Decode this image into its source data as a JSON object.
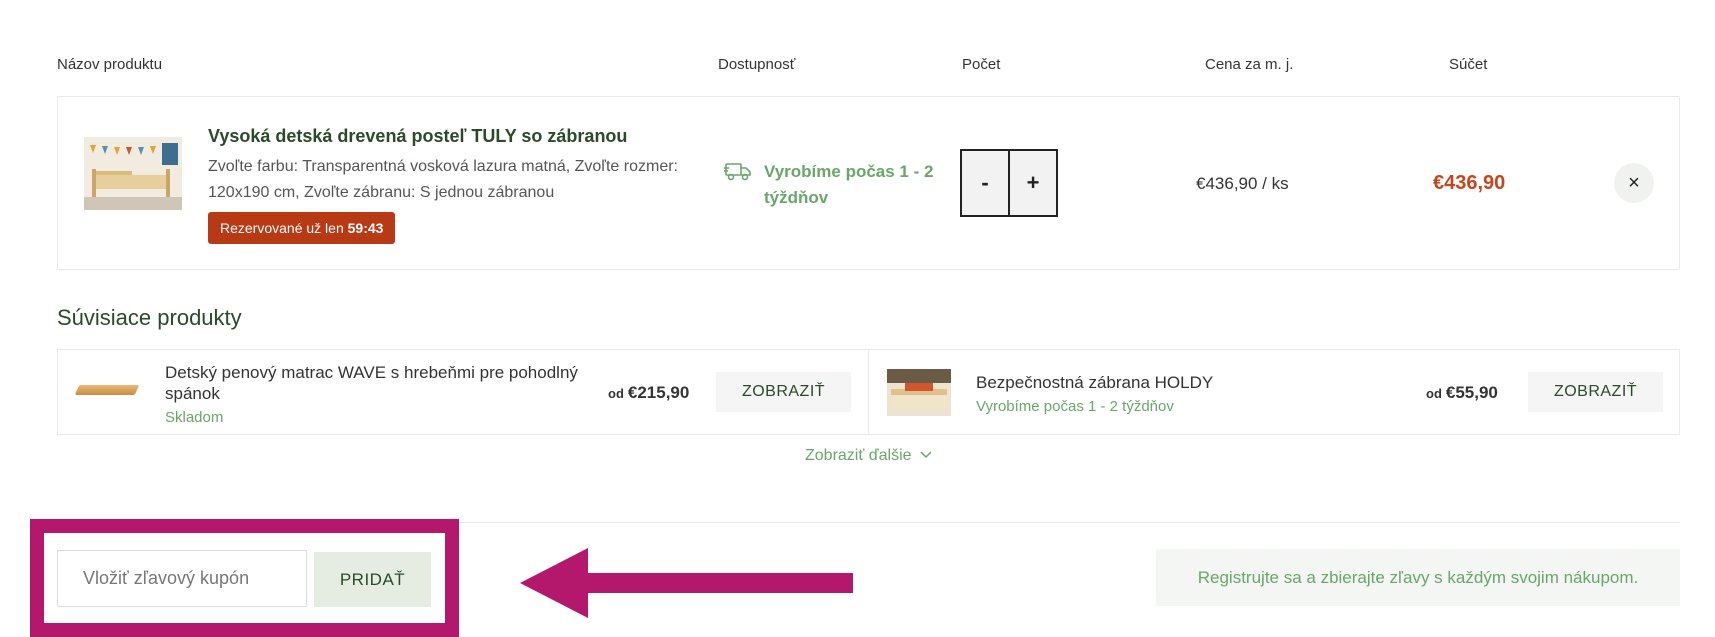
{
  "table_header": {
    "name": "Názov produktu",
    "availability": "Dostupnosť",
    "quantity": "Počet",
    "unit_price": "Cena za m. j.",
    "total": "Súčet"
  },
  "cart_item": {
    "title": "Vysoká detská drevená posteľ TULY so zábranou",
    "description": "Zvoľte farbu: Transparentná vosková lazura matná, Zvoľte rozmer: 120x190 cm, Zvoľte zábranu: S jednou zábranou",
    "reserve_label": "Rezervované už len",
    "reserve_time": "59:43",
    "availability": "Vyrobíme počas 1 - 2 týždňov",
    "minus": "-",
    "plus": "+",
    "unit_price": "€436,90 / ks",
    "total": "€436,90",
    "remove": "×"
  },
  "related": {
    "title": "Súvisiace produkty",
    "items": [
      {
        "name": "Detský penový matrac WAVE s hrebeňmi pre pohodlný spánok",
        "stock": "Skladom",
        "price_prefix": "od",
        "price": "€215,90",
        "button": "ZOBRAZIŤ"
      },
      {
        "name": "Bezpečnostná zábrana HOLDY",
        "stock": "Vyrobíme počas 1 - 2 týždňov",
        "price_prefix": "od",
        "price": "€55,90",
        "button": "ZOBRAZIŤ"
      }
    ],
    "show_more": "Zobraziť ďalšie"
  },
  "coupon": {
    "placeholder": "Vložiť zľavový kupón",
    "button": "PRIDAŤ"
  },
  "register_text": "Registrujte sa a zbierajte zľavy s každým svojim nákupom.",
  "colors": {
    "accent_green": "#6aa66a",
    "dark_green": "#2a4a2a",
    "price_red": "#c8441c",
    "reserve_bg": "#b83a14",
    "highlight_magenta": "#b3186c"
  }
}
